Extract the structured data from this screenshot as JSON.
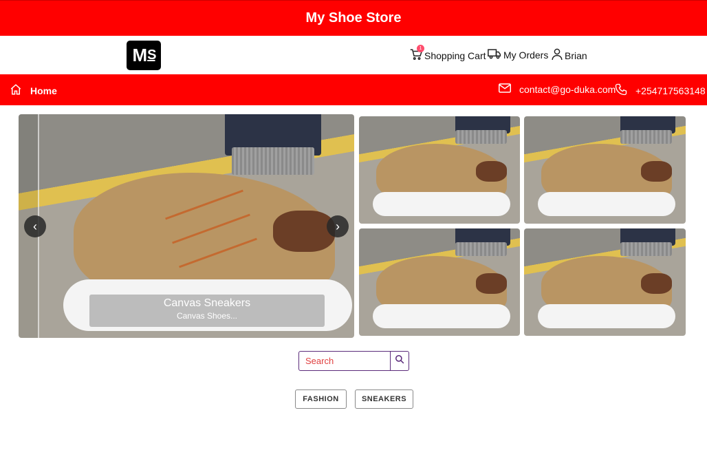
{
  "app": {
    "title": "My Shoe Store"
  },
  "header": {
    "logo_text": "M",
    "logo_text_s": "S",
    "cart_label": "Shopping Cart",
    "cart_count": "1",
    "orders_label": "My Orders",
    "user_label": "Brian"
  },
  "nav": {
    "home_label": "Home",
    "email": "contact@go-duka.com",
    "phone": "+254717563148"
  },
  "carousel": {
    "caption_title": "Canvas Sneakers",
    "caption_subtitle": "Canvas Shoes...",
    "prev_symbol": "‹",
    "next_symbol": "›"
  },
  "search": {
    "placeholder": "Search"
  },
  "categories": [
    "FASHION",
    "SNEAKERS"
  ],
  "colors": {
    "brand": "#ff0000",
    "search_border": "#5a2a7a",
    "badge": "#ff4d6d"
  }
}
